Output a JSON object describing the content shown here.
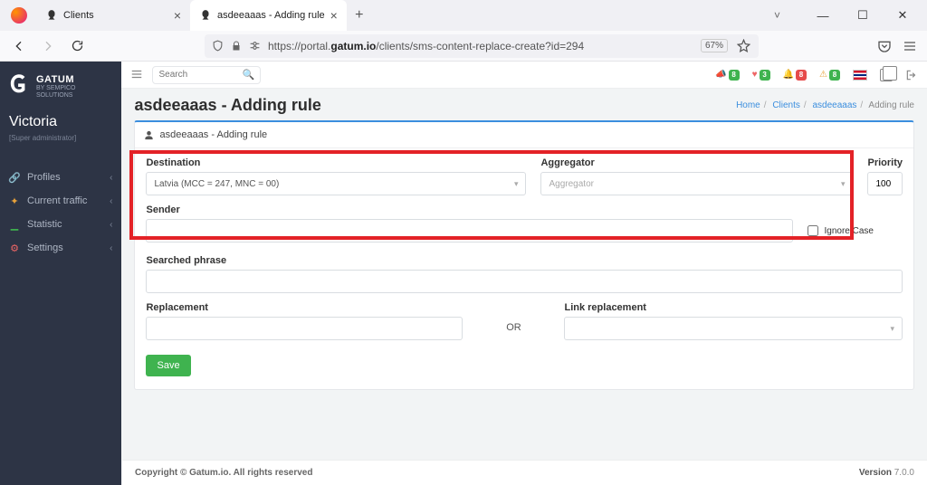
{
  "browser": {
    "tabs": [
      {
        "title": "Clients"
      },
      {
        "title": "asdeeaaas - Adding rule"
      }
    ],
    "url_prefix": "https://portal.",
    "url_bold": "gatum.io",
    "url_suffix": "/clients/sms-content-replace-create?id=294",
    "zoom": "67%"
  },
  "sidebar": {
    "brand_name": "GATUM",
    "brand_sub": "BY SEMPICO SOLUTIONS",
    "user_name": "Victoria",
    "user_role": "[Super administrator]",
    "items": [
      {
        "label": "Profiles"
      },
      {
        "label": "Current traffic"
      },
      {
        "label": "Statistic"
      },
      {
        "label": "Settings"
      }
    ]
  },
  "topbar": {
    "search_placeholder": "Search",
    "badges": [
      "8",
      "3",
      "8",
      "8"
    ]
  },
  "breadcrumbs": {
    "home": "Home",
    "clients": "Clients",
    "client": "asdeeaaas",
    "current": "Adding rule"
  },
  "page": {
    "title": "asdeeaaas - Adding rule",
    "panel_title": "asdeeaaas - Adding rule",
    "labels": {
      "destination": "Destination",
      "aggregator": "Aggregator",
      "priority": "Priority",
      "sender": "Sender",
      "ignore_case": "Ignore Case",
      "searched_phrase": "Searched phrase",
      "replacement": "Replacement",
      "or": "OR",
      "link_replacement": "Link replacement"
    },
    "values": {
      "destination": "Latvia (MCC = 247, MNC = 00)",
      "aggregator_placeholder": "Aggregator",
      "priority": "100"
    },
    "save_label": "Save"
  },
  "footer": {
    "copyright": "Copyright © Gatum.io. All rights reserved",
    "version_label": "Version",
    "version": "7.0.0"
  }
}
